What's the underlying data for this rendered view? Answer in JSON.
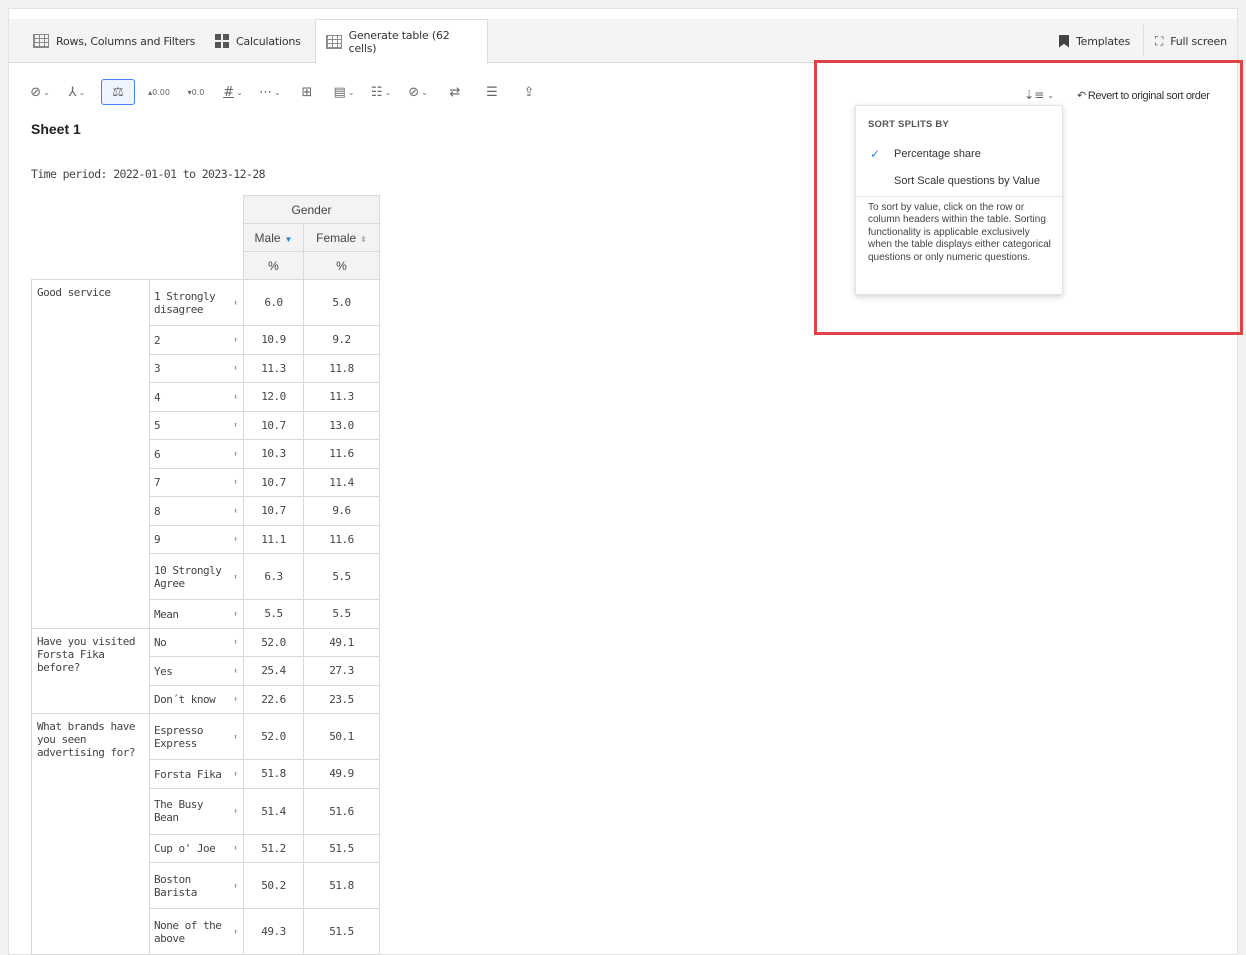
{
  "tabs": [
    {
      "label": "Rows, Columns and Filters",
      "icon": "grid-icon"
    },
    {
      "label": "Calculations",
      "icon": "calculator-icon"
    },
    {
      "label": "Generate table (62 cells)",
      "icon": "table-icon"
    }
  ],
  "header_right": {
    "templates": "Templates",
    "fullscreen": "Full screen"
  },
  "sheet": {
    "title": "Sheet 1",
    "period": "Time period: 2022-01-01 to 2023-12-28"
  },
  "sort_control": {
    "revert": "Revert to original sort order"
  },
  "dropdown": {
    "heading": "SORT SPLITS BY",
    "items": [
      {
        "label": "Percentage share",
        "checked": true
      },
      {
        "label": "Sort Scale questions by Value",
        "checked": false
      }
    ],
    "note": "To sort by value, click on the row or column headers within the table. Sorting functionality is applicable exclusively when the table displays either categorical questions or only numeric questions."
  },
  "table": {
    "group_header": "Gender",
    "col_headers": [
      "Male",
      "Female"
    ],
    "units": [
      "%",
      "%"
    ],
    "questions": [
      {
        "label": "Good service",
        "rows": [
          {
            "cat": "1 Strongly disagree",
            "male": "6.0",
            "female": "5.0"
          },
          {
            "cat": "2",
            "male": "10.9",
            "female": "9.2"
          },
          {
            "cat": "3",
            "male": "11.3",
            "female": "11.8"
          },
          {
            "cat": "4",
            "male": "12.0",
            "female": "11.3"
          },
          {
            "cat": "5",
            "male": "10.7",
            "female": "13.0"
          },
          {
            "cat": "6",
            "male": "10.3",
            "female": "11.6"
          },
          {
            "cat": "7",
            "male": "10.7",
            "female": "11.4"
          },
          {
            "cat": "8",
            "male": "10.7",
            "female": "9.6"
          },
          {
            "cat": "9",
            "male": "11.1",
            "female": "11.6"
          },
          {
            "cat": "10 Strongly Agree",
            "male": "6.3",
            "female": "5.5"
          },
          {
            "cat": "Mean",
            "male": "5.5",
            "female": "5.5"
          }
        ]
      },
      {
        "label": "Have you visited Forsta Fika before?",
        "rows": [
          {
            "cat": "No",
            "male": "52.0",
            "female": "49.1"
          },
          {
            "cat": "Yes",
            "male": "25.4",
            "female": "27.3"
          },
          {
            "cat": "Don´t know",
            "male": "22.6",
            "female": "23.5"
          }
        ]
      },
      {
        "label": "What brands have you seen advertising for?",
        "rows": [
          {
            "cat": "Espresso Express",
            "male": "52.0",
            "female": "50.1"
          },
          {
            "cat": "Forsta Fika",
            "male": "51.8",
            "female": "49.9"
          },
          {
            "cat": "The Busy Bean",
            "male": "51.4",
            "female": "51.6"
          },
          {
            "cat": "Cup o' Joe",
            "male": "51.2",
            "female": "51.5"
          },
          {
            "cat": "Boston Barista",
            "male": "50.2",
            "female": "51.8"
          },
          {
            "cat": "None of the above",
            "male": "49.3",
            "female": "51.5"
          }
        ]
      }
    ]
  }
}
